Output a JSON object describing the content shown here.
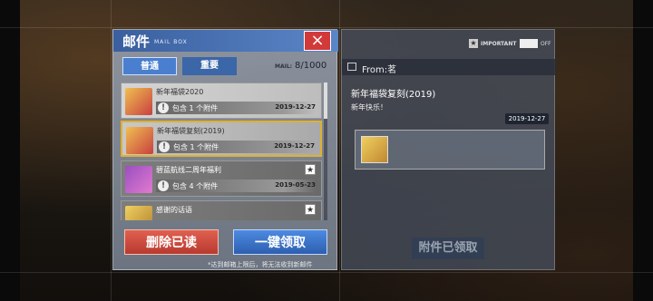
{
  "window": {
    "title": "邮件",
    "subtitle": "MAIL BOX",
    "close_label": "×"
  },
  "tabs": [
    {
      "label": "普通"
    },
    {
      "label": "重要"
    }
  ],
  "mail_counter": {
    "label": "MAIL:",
    "value": "8/1000"
  },
  "mail_list": [
    {
      "title": "新年福袋2020",
      "attachment_text": "包含 1 个附件",
      "date": "2019-12-27",
      "icon": "lucky-bag-icon",
      "starred": false
    },
    {
      "title": "新年福袋复刻(2019)",
      "attachment_text": "包含 1 个附件",
      "date": "2019-12-27",
      "icon": "lucky-bag-icon",
      "starred": false,
      "selected": true
    },
    {
      "title": "碧蓝航线二周年福利",
      "attachment_text": "包含 4 个附件",
      "date": "2019-05-23",
      "icon": "ship-gift-icon",
      "starred": true
    },
    {
      "title": "感谢的话语",
      "attachment_text": "",
      "date": "",
      "icon": "gift-icon",
      "starred": true
    }
  ],
  "buttons": {
    "delete_read": "删除已读",
    "claim_all": "一键领取"
  },
  "footnote": "*达到邮箱上限后，将无法收到新邮件",
  "detail": {
    "important_label": "IMPORTANT",
    "toggle_label": "OFF",
    "from": "From:茗",
    "title": "新年福袋复刻(2019)",
    "body": "新年快乐！",
    "date": "2019-12-27",
    "claimed_label": "附件已领取"
  }
}
